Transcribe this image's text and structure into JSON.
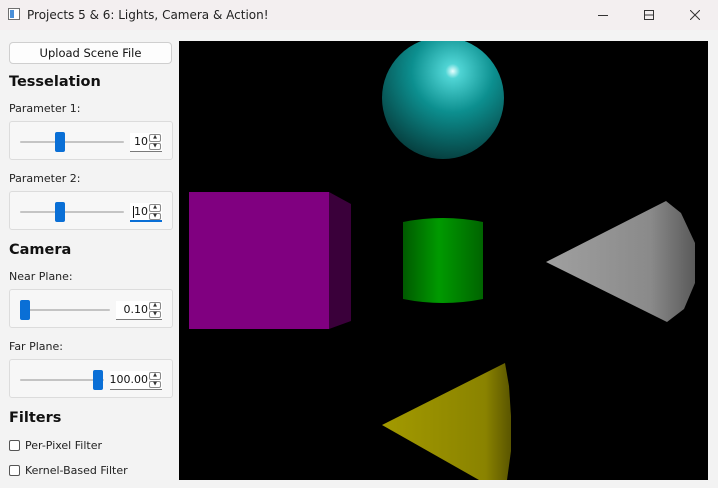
{
  "window": {
    "title": "Projects 5 & 6: Lights, Camera & Action!",
    "controls": [
      "minimize",
      "maximize",
      "close"
    ]
  },
  "sidebar": {
    "upload_button": "Upload Scene File",
    "tesselation": {
      "heading": "Tesselation",
      "param1": {
        "label": "Parameter 1:",
        "value": "10"
      },
      "param2": {
        "label": "Parameter 2:",
        "value": "10"
      }
    },
    "camera": {
      "heading": "Camera",
      "near": {
        "label": "Near Plane:",
        "value": "0.10"
      },
      "far": {
        "label": "Far Plane:",
        "value": "100.00"
      }
    },
    "filters": {
      "heading": "Filters",
      "per_pixel": {
        "label": "Per-Pixel Filter",
        "checked": false
      },
      "kernel": {
        "label": "Kernel-Based Filter",
        "checked": false
      }
    }
  },
  "scene": {
    "background": "#000000",
    "objects": [
      {
        "shape": "sphere",
        "color": "#0d8c8c"
      },
      {
        "shape": "cube",
        "color": "#800080"
      },
      {
        "shape": "cylinder",
        "color": "#008a00"
      },
      {
        "shape": "cone",
        "color": "#8a8a8a"
      },
      {
        "shape": "cone",
        "color": "#8c8400"
      }
    ]
  },
  "colors": {
    "accent": "#0a6fd6",
    "panel_bg": "#f3f3f3",
    "titlebar_bg": "#f3eff0"
  }
}
